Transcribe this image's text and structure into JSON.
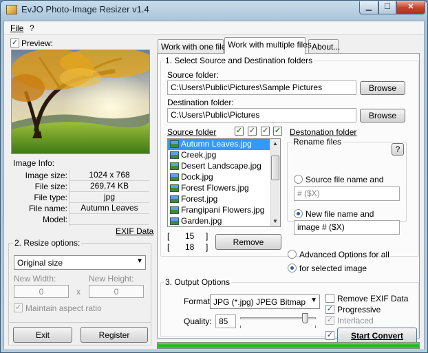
{
  "window": {
    "title": "EvJO Photo-Image Resizer v1.4",
    "min": "▁",
    "max": "☐",
    "close": "✕"
  },
  "menu": {
    "file": "File",
    "help": "?"
  },
  "preview": {
    "label": "Preview:",
    "checked": true
  },
  "image_info": {
    "label": "Image Info:",
    "rows": [
      {
        "key": "Image size:",
        "value": "1024 x 768"
      },
      {
        "key": "File size:",
        "value": "269,74 KB"
      },
      {
        "key": "File type:",
        "value": "jpg"
      },
      {
        "key": "File name:",
        "value": "Autumn Leaves"
      },
      {
        "key": "Model:",
        "value": ""
      }
    ],
    "exif_link": "EXIF Data"
  },
  "resize": {
    "label": "2. Resize options:",
    "mode": "Original size",
    "width_label": "New Width:",
    "height_label": "New Height:",
    "width": "0",
    "height": "0",
    "times": "x",
    "aspect_label": "Maintain aspect ratio"
  },
  "buttons": {
    "exit": "Exit",
    "register": "Register"
  },
  "tabs": [
    "Work with one file",
    "Work with multiple files",
    "About..."
  ],
  "section1": {
    "label": "1. Select Source and Destination folders",
    "source_label": "Source folder:",
    "source_value": "C:\\Users\\Public\\Pictures\\Sample Pictures",
    "dest_label": "Destination folder:",
    "dest_value": "C:\\Users\\Public\\Pictures",
    "browse": "Browse"
  },
  "filelist": {
    "source_link": "Source folder",
    "dest_link": "Destonation folder",
    "items": [
      "Autumn Leaves.jpg",
      "Creek.jpg",
      "Desert Landscape.jpg",
      "Dock.jpg",
      "Forest Flowers.jpg",
      "Forest.jpg",
      "Frangipani Flowers.jpg",
      "Garden.jpg"
    ],
    "selected_count": "15",
    "total_count": "18",
    "bracket_open": "[",
    "bracket_close": "]",
    "remove": "Remove"
  },
  "rename": {
    "label": "Rename files",
    "help": "?",
    "opt_source": "Source file name and",
    "source_pattern": "# ($X)",
    "opt_new": "New file name and",
    "new_pattern": "image # ($X)"
  },
  "advanced": {
    "opt_all": "Advanced Options for all",
    "opt_selected": "for selected image"
  },
  "output": {
    "label": "3. Output Options",
    "format_label": "Format:",
    "format_value": "JPG (*.jpg) JPEG Bitmap",
    "quality_label": "Quality:",
    "quality_value": "85",
    "quality_fraction": 0.85,
    "remove_exif": "Remove EXIF Data",
    "progressive": "Progressive",
    "interlaced": "Interlaced",
    "start": "Start Convert"
  },
  "progress": {
    "fraction": 1.0
  },
  "colors": {
    "progress": "#12b912",
    "selection": "#3399ff",
    "check_green": "#1a9b1a"
  }
}
